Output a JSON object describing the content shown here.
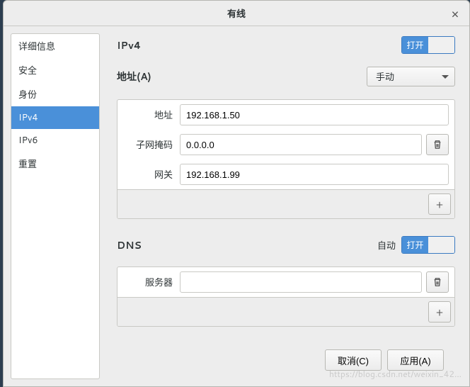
{
  "title": "有线",
  "sidebar": {
    "items": [
      {
        "label": "详细信息"
      },
      {
        "label": "安全"
      },
      {
        "label": "身份"
      },
      {
        "label": "IPv4"
      },
      {
        "label": "IPv6"
      },
      {
        "label": "重置"
      }
    ],
    "selected_index": 3
  },
  "ipv4": {
    "heading": "IPv4",
    "switch_label": "打开",
    "addresses_heading": "地址(A)",
    "mode_label": "手动",
    "fields": {
      "address_label": "地址",
      "address_value": "192.168.1.50",
      "netmask_label": "子网掩码",
      "netmask_value": "0.0.0.0",
      "gateway_label": "网关",
      "gateway_value": "192.168.1.99"
    }
  },
  "dns": {
    "heading": "DNS",
    "auto_label": "自动",
    "switch_label": "打开",
    "server_label": "服务器",
    "server_value": ""
  },
  "buttons": {
    "cancel": "取消(C)",
    "apply": "应用(A)"
  },
  "icons": {
    "add": "+",
    "close": "×"
  },
  "watermark": "https://blog.csdn.net/weixin_42..."
}
